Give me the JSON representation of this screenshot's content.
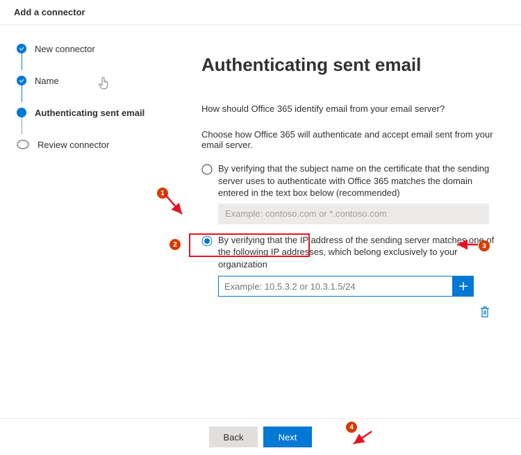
{
  "header": {
    "title": "Add a connector"
  },
  "steps": [
    {
      "label": "New connector",
      "state": "completed"
    },
    {
      "label": "Name",
      "state": "completed"
    },
    {
      "label": "Authenticating sent email",
      "state": "current"
    },
    {
      "label": "Review connector",
      "state": "pending"
    }
  ],
  "main": {
    "heading": "Authenticating sent email",
    "question": "How should Office 365 identify email from your email server?",
    "instruction": "Choose how Office 365 will authenticate and accept email sent from your email server.",
    "option_cert": {
      "label": "By verifying that the subject name on the certificate that the sending server uses to authenticate with Office 365 matches the domain entered in the text box below (recommended)",
      "placeholder": "Example: contoso.com or *.contoso.com",
      "selected": false
    },
    "option_ip": {
      "label": "By verifying that the IP address of the sending server matches one of the following IP addresses, which belong exclusively to your organization",
      "placeholder": "Example: 10.5.3.2 or 10.3.1.5/24",
      "value": "",
      "selected": true
    }
  },
  "footer": {
    "back": "Back",
    "next": "Next"
  },
  "annotations": {
    "callouts": [
      "1",
      "2",
      "3",
      "4"
    ]
  },
  "icons": {
    "hand": "hand-cursor-icon",
    "add": "plus-icon",
    "trash": "trash-icon"
  }
}
